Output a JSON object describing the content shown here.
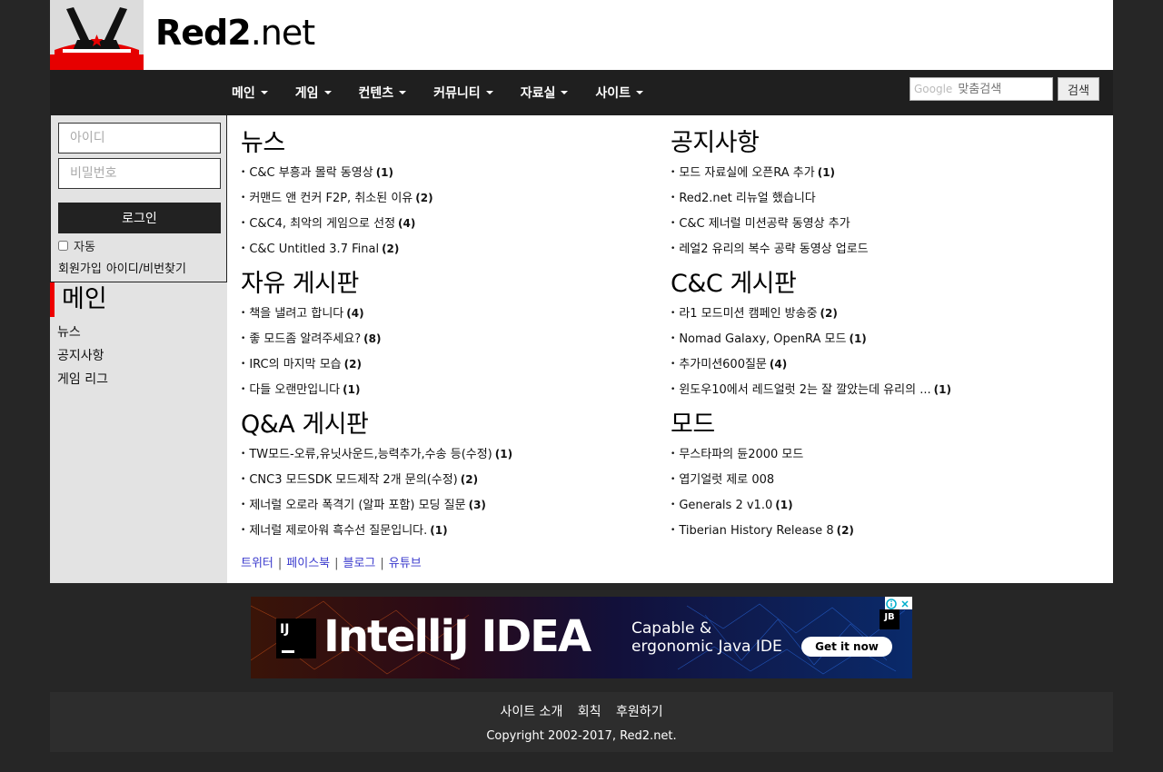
{
  "header": {
    "title_bold": "Red2",
    "title_rest": ".net"
  },
  "nav": {
    "items": [
      "메인",
      "게임",
      "컨텐츠",
      "커뮤니티",
      "자료실",
      "사이트"
    ],
    "search_logo": "Google",
    "search_placeholder": "맞춤검색",
    "search_button": "검색"
  },
  "login": {
    "id_placeholder": "아이디",
    "pw_placeholder": "비밀번호",
    "login_button": "로그인",
    "auto_label": "자동",
    "signup": "회원가입",
    "find": "아이디/비번찾기"
  },
  "sidebar": {
    "title": "메인",
    "links": [
      "뉴스",
      "공지사항",
      "게임 리그"
    ]
  },
  "sections": [
    {
      "title": "뉴스",
      "posts": [
        {
          "text": "C&C 부흥과 몰락 동영상",
          "count": "(1)"
        },
        {
          "text": "커맨드 앤 컨커 F2P, 취소된 이유",
          "count": "(2)"
        },
        {
          "text": "C&C4, 최악의 게임으로 선정",
          "count": "(4)"
        },
        {
          "text": "C&C Untitled 3.7 Final",
          "count": "(2)"
        }
      ]
    },
    {
      "title": "공지사항",
      "posts": [
        {
          "text": "모드 자료실에 오픈RA 추가",
          "count": "(1)"
        },
        {
          "text": "Red2.net 리뉴얼 했습니다",
          "count": ""
        },
        {
          "text": "C&C 제너럴 미션공략 동영상 추가",
          "count": ""
        },
        {
          "text": "레얼2 유리의 복수 공략 동영상 업로드",
          "count": ""
        }
      ]
    },
    {
      "title": "자유 게시판",
      "posts": [
        {
          "text": "책을 낼려고 합니다",
          "count": "(4)"
        },
        {
          "text": "좋 모드좀 알려주세요?",
          "count": "(8)"
        },
        {
          "text": "IRC의 마지막 모습",
          "count": "(2)"
        },
        {
          "text": "다들 오랜만입니다",
          "count": "(1)"
        }
      ]
    },
    {
      "title": "C&C 게시판",
      "posts": [
        {
          "text": "라1 모드미션 캠페인 방송중",
          "count": "(2)"
        },
        {
          "text": "Nomad Galaxy, OpenRA 모드",
          "count": "(1)"
        },
        {
          "text": "추가미션600질문",
          "count": "(4)"
        },
        {
          "text": "윈도우10에서 레드얼럿 2는 잘 깔았는데 유리의 ...",
          "count": "(1)"
        }
      ]
    },
    {
      "title": "Q&A 게시판",
      "posts": [
        {
          "text": "TW모드-오류,유닛사운드,능력추가,수송 등(수정)",
          "count": "(1)"
        },
        {
          "text": "CNC3 모드SDK 모드제작 2개 문의(수정)",
          "count": "(2)"
        },
        {
          "text": "제너럴 오로라 폭격기 (알파 포함) 모딩 질문",
          "count": "(3)"
        },
        {
          "text": "제너럴 제로아워 흑수선 질문입니다.",
          "count": "(1)"
        }
      ]
    },
    {
      "title": "모드",
      "posts": [
        {
          "text": "무스타파의 듄2000 모드",
          "count": ""
        },
        {
          "text": "엽기얼럿 제로 008",
          "count": ""
        },
        {
          "text": "Generals 2 v1.0",
          "count": "(1)"
        },
        {
          "text": "Tiberian History Release 8",
          "count": "(2)"
        }
      ]
    }
  ],
  "social": [
    "트위터",
    "페이스북",
    "블로그",
    "유튜브"
  ],
  "ad": {
    "badge": "IJ",
    "product": "IntelliJ IDEA",
    "tagline_1": "Capable &",
    "tagline_2": "ergonomic Java IDE",
    "cta": "Get it now",
    "brand": "JB"
  },
  "footer": {
    "links": [
      "사이트 소개",
      "회칙",
      "후원하기"
    ],
    "copyright": "Copyright 2002-2017, Red2.net."
  },
  "colors": {
    "accent": "#e00000",
    "nav_bg": "#1f1f1f",
    "link": "#3a3acd"
  }
}
